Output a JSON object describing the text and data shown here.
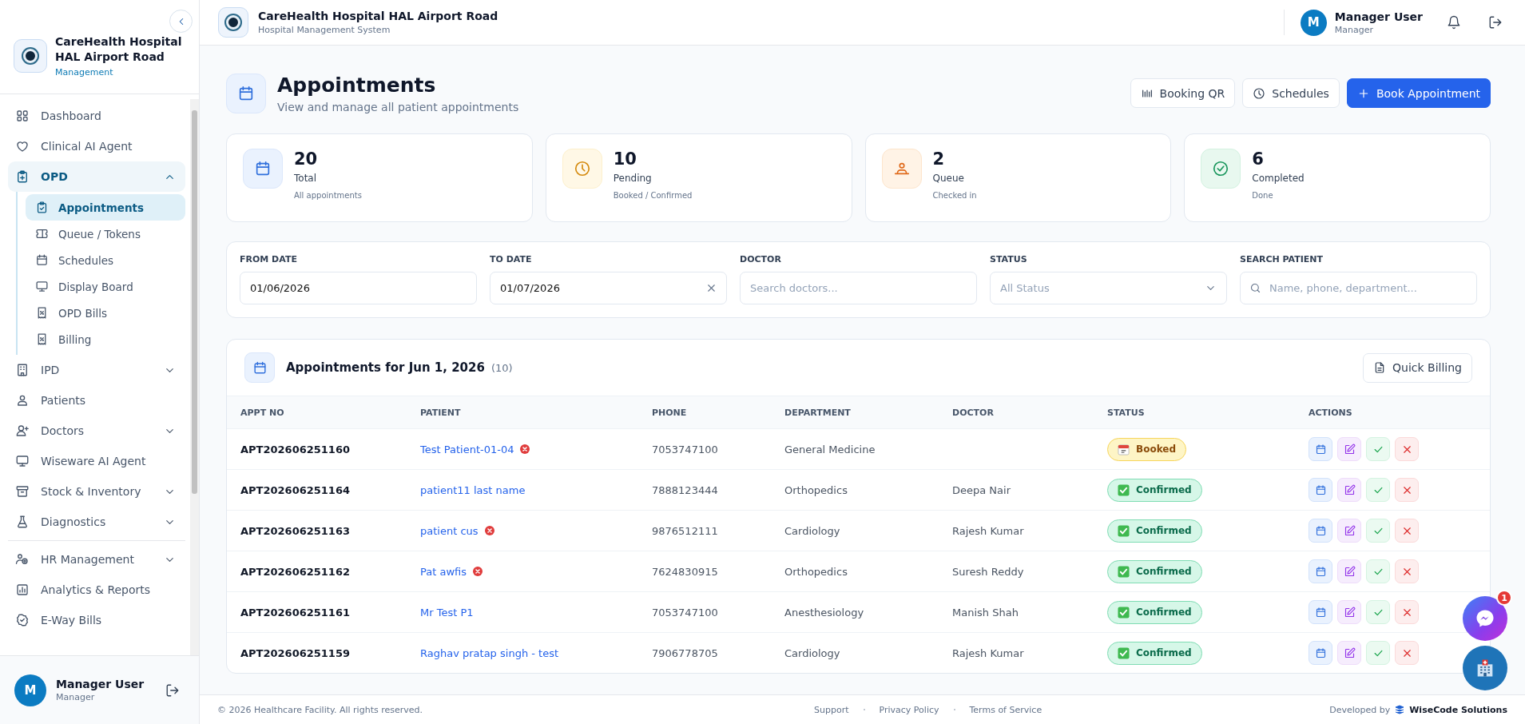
{
  "sidebar": {
    "brand": {
      "name": "CareHealth Hospital HAL Airport Road",
      "subtitle": "Management"
    },
    "groups": [
      [
        {
          "label": "Dashboard",
          "expandable": false,
          "expanded": false,
          "selected": false
        },
        {
          "label": "Clinical AI Agent",
          "expandable": false,
          "expanded": false,
          "selected": false
        },
        {
          "label": "OPD",
          "expandable": true,
          "expanded": true,
          "selected": false,
          "children": [
            {
              "label": "Appointments",
              "selected": true
            },
            {
              "label": "Queue / Tokens",
              "selected": false
            },
            {
              "label": "Schedules",
              "selected": false
            },
            {
              "label": "Display Board",
              "selected": false
            },
            {
              "label": "OPD Bills",
              "selected": false
            },
            {
              "label": "Billing",
              "selected": false
            }
          ]
        },
        {
          "label": "IPD",
          "expandable": true,
          "expanded": false,
          "selected": false
        },
        {
          "label": "Patients",
          "expandable": false,
          "expanded": false,
          "selected": false
        },
        {
          "label": "Doctors",
          "expandable": true,
          "expanded": false,
          "selected": false
        },
        {
          "label": "Wiseware AI Agent",
          "expandable": false,
          "expanded": false,
          "selected": false
        },
        {
          "label": "Stock & Inventory",
          "expandable": true,
          "expanded": false,
          "selected": false
        },
        {
          "label": "Diagnostics",
          "expandable": true,
          "expanded": false,
          "selected": false
        }
      ],
      [
        {
          "label": "HR Management",
          "expandable": true,
          "expanded": false,
          "selected": false
        },
        {
          "label": "Analytics & Reports",
          "expandable": false,
          "expanded": false,
          "selected": false
        },
        {
          "label": "E-Way Bills",
          "expandable": false,
          "expanded": false,
          "selected": false
        }
      ]
    ],
    "user": {
      "initial": "M",
      "name": "Manager User",
      "role": "Manager"
    }
  },
  "header": {
    "title": "CareHealth Hospital HAL Airport Road",
    "subtitle": "Hospital Management System",
    "user": {
      "initial": "M",
      "name": "Manager User",
      "role": "Manager"
    }
  },
  "page": {
    "title": "Appointments",
    "subtitle": "View and manage all patient appointments",
    "actions": [
      {
        "kind": "qr",
        "label": "Booking QR",
        "primary": false
      },
      {
        "kind": "schedules",
        "label": "Schedules",
        "primary": false
      },
      {
        "kind": "add",
        "label": "Book Appointment",
        "primary": true
      }
    ]
  },
  "stats": [
    {
      "kind": "total",
      "value": "20",
      "label": "Total",
      "note": "All appointments"
    },
    {
      "kind": "pending",
      "value": "10",
      "label": "Pending",
      "note": "Booked / Confirmed"
    },
    {
      "kind": "queue",
      "value": "2",
      "label": "Queue",
      "note": "Checked in"
    },
    {
      "kind": "completed",
      "value": "6",
      "label": "Completed",
      "note": "Done"
    }
  ],
  "filters": [
    {
      "kind": "date",
      "label": "FROM DATE",
      "value": "01/06/2026",
      "clearable": false
    },
    {
      "kind": "date",
      "label": "TO DATE",
      "value": "01/07/2026",
      "clearable": true
    },
    {
      "kind": "text",
      "label": "DOCTOR",
      "placeholder": "Search doctors..."
    },
    {
      "kind": "select",
      "label": "STATUS",
      "placeholder": "All Status"
    },
    {
      "kind": "search",
      "label": "SEARCH PATIENT",
      "placeholder": "Name, phone, department..."
    }
  ],
  "appointments": {
    "title": "Appointments for Jun 1, 2026",
    "count": "(10)",
    "action": "Quick Billing",
    "columns": [
      "APPT NO",
      "PATIENT",
      "PHONE",
      "DEPARTMENT",
      "DOCTOR",
      "STATUS",
      "ACTIONS"
    ],
    "rows": [
      {
        "appt_no": "APT202606251160",
        "patient": "Test Patient-01-04",
        "flagged": true,
        "phone": "7053747100",
        "department": "General Medicine",
        "doctor": "",
        "status": {
          "kind": "booked",
          "label": "Booked"
        }
      },
      {
        "appt_no": "APT202606251164",
        "patient": "patient11 last name",
        "flagged": false,
        "phone": "7888123444",
        "department": "Orthopedics",
        "doctor": "Deepa Nair",
        "status": {
          "kind": "confirmed",
          "label": "Confirmed"
        }
      },
      {
        "appt_no": "APT202606251163",
        "patient": "patient cus",
        "flagged": true,
        "phone": "9876512111",
        "department": "Cardiology",
        "doctor": "Rajesh Kumar",
        "status": {
          "kind": "confirmed",
          "label": "Confirmed"
        }
      },
      {
        "appt_no": "APT202606251162",
        "patient": "Pat awfis",
        "flagged": true,
        "phone": "7624830915",
        "department": "Orthopedics",
        "doctor": "Suresh Reddy",
        "status": {
          "kind": "confirmed",
          "label": "Confirmed"
        }
      },
      {
        "appt_no": "APT202606251161",
        "patient": "Mr Test P1",
        "flagged": false,
        "phone": "7053747100",
        "department": "Anesthesiology",
        "doctor": "Manish Shah",
        "status": {
          "kind": "confirmed",
          "label": "Confirmed"
        }
      },
      {
        "appt_no": "APT202606251159",
        "patient": "Raghav pratap singh - test",
        "flagged": false,
        "phone": "7906778705",
        "department": "Cardiology",
        "doctor": "Rajesh Kumar",
        "status": {
          "kind": "confirmed",
          "label": "Confirmed"
        }
      }
    ]
  },
  "footer": {
    "copyright": "© 2026 Healthcare Facility. All rights reserved.",
    "links": [
      "Support",
      "Privacy Policy",
      "Terms of Service"
    ],
    "credit_prefix": "Developed by",
    "credit": "WiseCode Solutions"
  },
  "chat": {
    "badge": "1"
  }
}
